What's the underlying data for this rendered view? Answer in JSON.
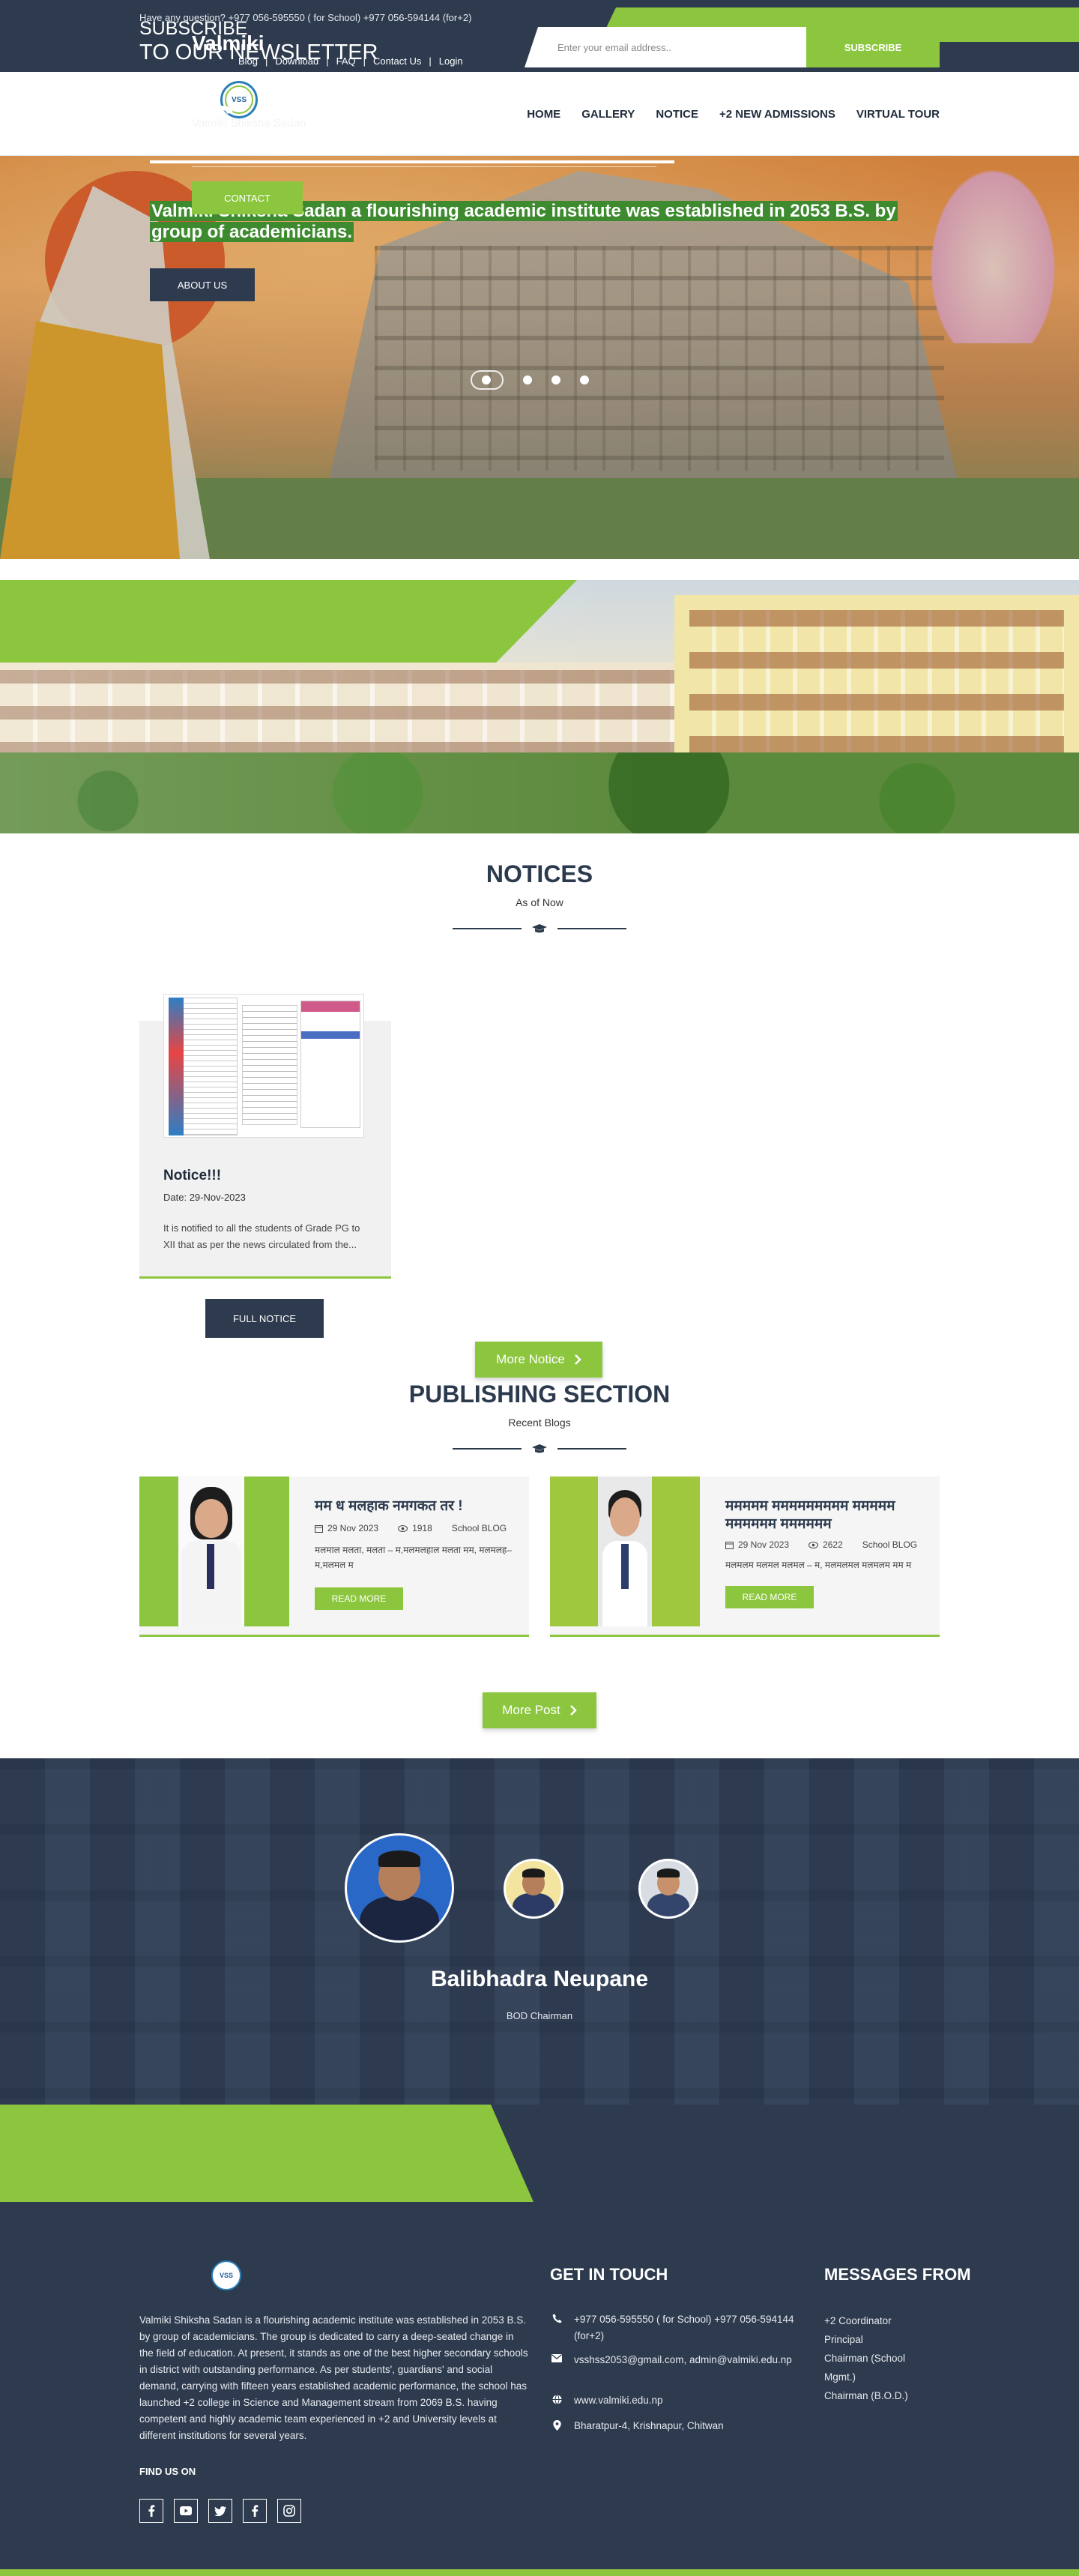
{
  "topbar": {
    "question": "Have any question? +977 056-595550 ( for School) +977 056-594144 (for+2)",
    "links": [
      "Blog",
      "Download",
      "FAQ",
      "Contact Us",
      "Login"
    ]
  },
  "header": {
    "logo_text": "VSS",
    "nav": [
      "HOME",
      "GALLERY",
      "NOTICE",
      "+2 NEW ADMISSIONS",
      "VIRTUAL TOUR"
    ]
  },
  "hero": {
    "title": "VSS",
    "tagline": "Valmiki Shiksha Sadan a flourishing academic institute was established in 2053 B.S. by group of academicians.",
    "button": "ABOUT US",
    "slides_total": 4,
    "active_slide": 1
  },
  "about": {
    "title": "Valmiki",
    "subtitle": "Valmiki Shiksha Sadan",
    "button": "CONTACT"
  },
  "notices": {
    "title": "NOTICES",
    "subtitle": "As of Now",
    "items": [
      {
        "title": "Notice!!!",
        "date_label": "Date:",
        "date": "29-Nov-2023",
        "excerpt": "It is notified to all the students of Grade PG to XII that as per the news circulated from the...",
        "button": "FULL NOTICE"
      }
    ],
    "more_button": "More Notice"
  },
  "publishing": {
    "title": "PUBLISHING SECTION",
    "subtitle": "Recent Blogs",
    "posts": [
      {
        "title": "मम ध मलहाक नमगकत तर !",
        "date": "29 Nov 2023",
        "views": "1918",
        "category": "School BLOG",
        "excerpt": "मलमाल मलता, मलता – म,मलमलहाल मलता मम, मलमलह–म,मलमल म",
        "button": "READ MORE"
      },
      {
        "title": "ममममम ममममममममम ममममम मममममम मममममम",
        "date": "29 Nov 2023",
        "views": "2622",
        "category": "School BLOG",
        "excerpt": "मलमलम मलमल मलमल – म, मलमलमल मलमलम मम म",
        "button": "READ MORE"
      }
    ],
    "more_button": "More Post"
  },
  "bod": {
    "name": "Balibhadra Neupane",
    "role": "BOD Chairman"
  },
  "newsletter": {
    "line1": "SUBSCRIBE",
    "line2": "TO OUR NEWSLETTER",
    "placeholder": "Enter your email address..",
    "button": "SUBSCRIBE"
  },
  "footer": {
    "logo_text": "VSS",
    "about": "Valmiki Shiksha Sadan is a flourishing academic institute was established in 2053 B.S. by group of academicians. The group is dedicated to carry a deep-seated change in the field of education. At present, it stands as one of the best higher secondary schools in district with outstanding performance. As per students', guardians' and social demand, carrying with fifteen years established academic performance, the school has launched +2 college in Science and Management stream from 2069 B.S. having competent and highly academic team experienced in +2 and University levels at different institutions for several years.",
    "find_us": "FIND US ON",
    "contact_title": "GET IN TOUCH",
    "phone": "+977 056-595550 ( for School) +977 056-594144 (for+2)",
    "email": "vsshss2053@gmail.com, admin@valmiki.edu.np",
    "website": "www.valmiki.edu.np",
    "address": "Bharatpur-4, Krishnapur, Chitwan",
    "messages_title": "MESSAGES FROM",
    "messages": [
      "+2 Coordinator",
      "Principal",
      "Chairman (School Mgmt.)",
      "Chairman (B.O.D.)"
    ]
  },
  "colors": {
    "navy": "#2e3b4e",
    "green": "#8cc63f"
  }
}
